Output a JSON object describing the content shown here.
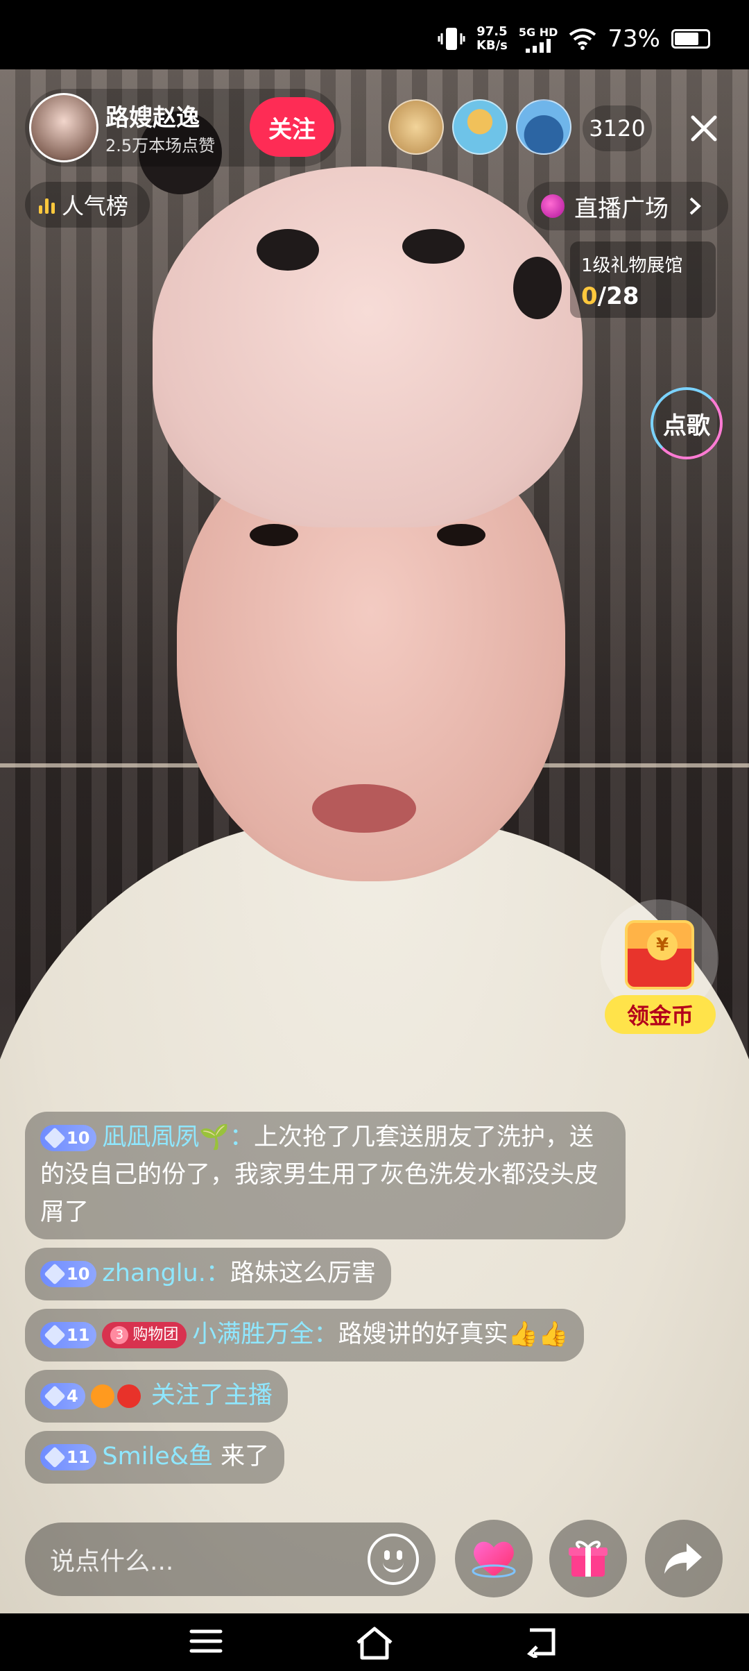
{
  "status_bar": {
    "net_speed_value": "97.5",
    "net_speed_unit": "KB/s",
    "network": "5G HD",
    "battery": "73%",
    "battery_level": 0.73
  },
  "host": {
    "name": "路嫂赵逸",
    "likes": "2.5万本场点赞",
    "follow_label": "关注"
  },
  "viewers": {
    "count": "3120"
  },
  "popularity": {
    "label": "人气榜"
  },
  "plaza": {
    "label": "直播广场"
  },
  "gift_museum": {
    "title": "1级礼物展馆",
    "current": "0",
    "total": "/28"
  },
  "song_button": {
    "label": "点歌"
  },
  "coin_widget": {
    "symbol": "¥",
    "label": "领金币"
  },
  "chat": [
    {
      "level": "10",
      "user": "凪凪凮夙🌱",
      "text": "上次抢了几套送朋友了洗护，送的没自己的份了，我家男生用了灰色洗发水都没头皮屑了"
    },
    {
      "level": "10",
      "user": "zhanglu.",
      "text": "路妹这么厉害"
    },
    {
      "level": "11",
      "fan_level": "3",
      "fan_group": "购物团",
      "user": "小满胜万全",
      "text": "路嫂讲的好真实👍👍"
    },
    {
      "level": "4",
      "action": "关注了主播"
    },
    {
      "level": "11",
      "user": "Smile&鱼",
      "text": "来了"
    }
  ],
  "comment": {
    "placeholder": "说点什么..."
  }
}
